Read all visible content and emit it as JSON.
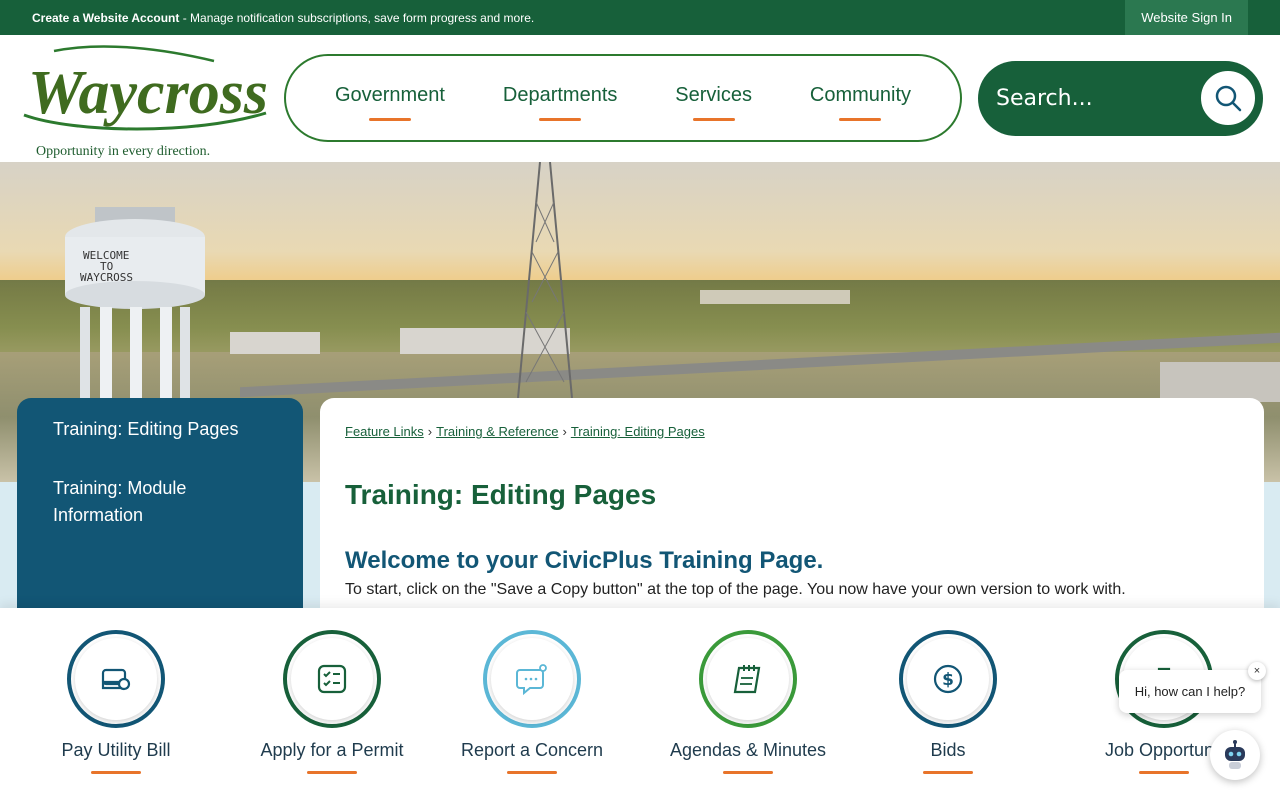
{
  "topbar": {
    "account_link": "Create a Website Account",
    "message": " - Manage notification subscriptions, save form progress and more.",
    "signin": "Website Sign In"
  },
  "logo": {
    "name": "Waycross",
    "tagline": "Opportunity in every direction."
  },
  "nav": {
    "items": [
      "Government",
      "Departments",
      "Services",
      "Community"
    ]
  },
  "search": {
    "placeholder": "Search..."
  },
  "hero": {
    "tower_text": [
      "WELCOME",
      "TO",
      "WAYCROSS"
    ]
  },
  "sidebar": {
    "items": [
      "Training: Editing Pages",
      "Training: Module Information"
    ]
  },
  "breadcrumb": {
    "items": [
      "Feature Links",
      "Training & Reference",
      "Training: Editing Pages"
    ],
    "separator": "›"
  },
  "content": {
    "title": "Training: Editing Pages",
    "subtitle": "Welcome to your CivicPlus Training Page.",
    "body": "To start, click on the \"Save a Copy button\" at the top of the page. You now have your own version to work with."
  },
  "quick_links": [
    {
      "label": "Pay Utility Bill",
      "icon": "wallet-icon",
      "color": "#125675"
    },
    {
      "label": "Apply for a Permit",
      "icon": "checklist-icon",
      "color": "#17603a"
    },
    {
      "label": "Report a Concern",
      "icon": "chat-bubble-icon",
      "color": "#5bb7d6"
    },
    {
      "label": "Agendas & Minutes",
      "icon": "notepad-icon",
      "color": "#3a9a3a"
    },
    {
      "label": "Bids",
      "icon": "dollar-icon",
      "color": "#125675"
    },
    {
      "label": "Job Opportunit",
      "icon": "briefcase-icon",
      "color": "#17603a"
    }
  ],
  "chat": {
    "message": "Hi, how can I help?",
    "close": "×"
  },
  "colors": {
    "brand_green": "#17603a",
    "brand_blue": "#125675",
    "accent_orange": "#e8742a"
  }
}
